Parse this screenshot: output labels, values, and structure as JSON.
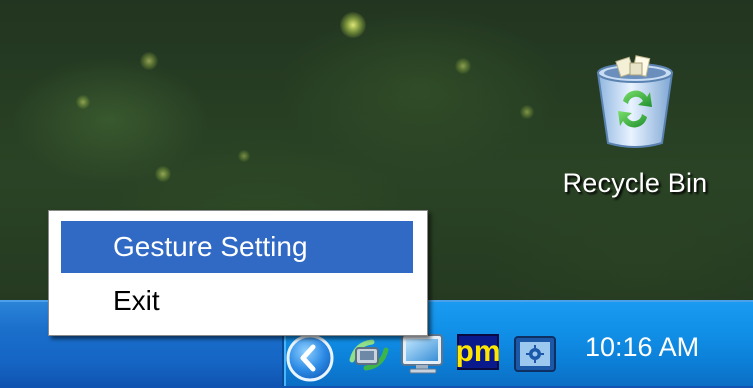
{
  "desktop": {
    "icons": [
      {
        "label": "Recycle Bin",
        "icon": "recycle-bin-icon"
      }
    ]
  },
  "context_menu": {
    "items": [
      {
        "label": "Gesture Setting",
        "highlighted": true
      },
      {
        "label": "Exit",
        "highlighted": false
      }
    ]
  },
  "taskbar": {
    "tray": {
      "icons": [
        "show-hidden-icons-chevron",
        "network-connection-icon",
        "monitor-display-icon",
        "pm-app-icon",
        "control-app-icon"
      ],
      "pm_label": "pm",
      "clock": "10:16 AM"
    }
  },
  "colors": {
    "taskbar": "#1565c4",
    "tray": "#1190e8",
    "menu_highlight": "#316ac5"
  }
}
